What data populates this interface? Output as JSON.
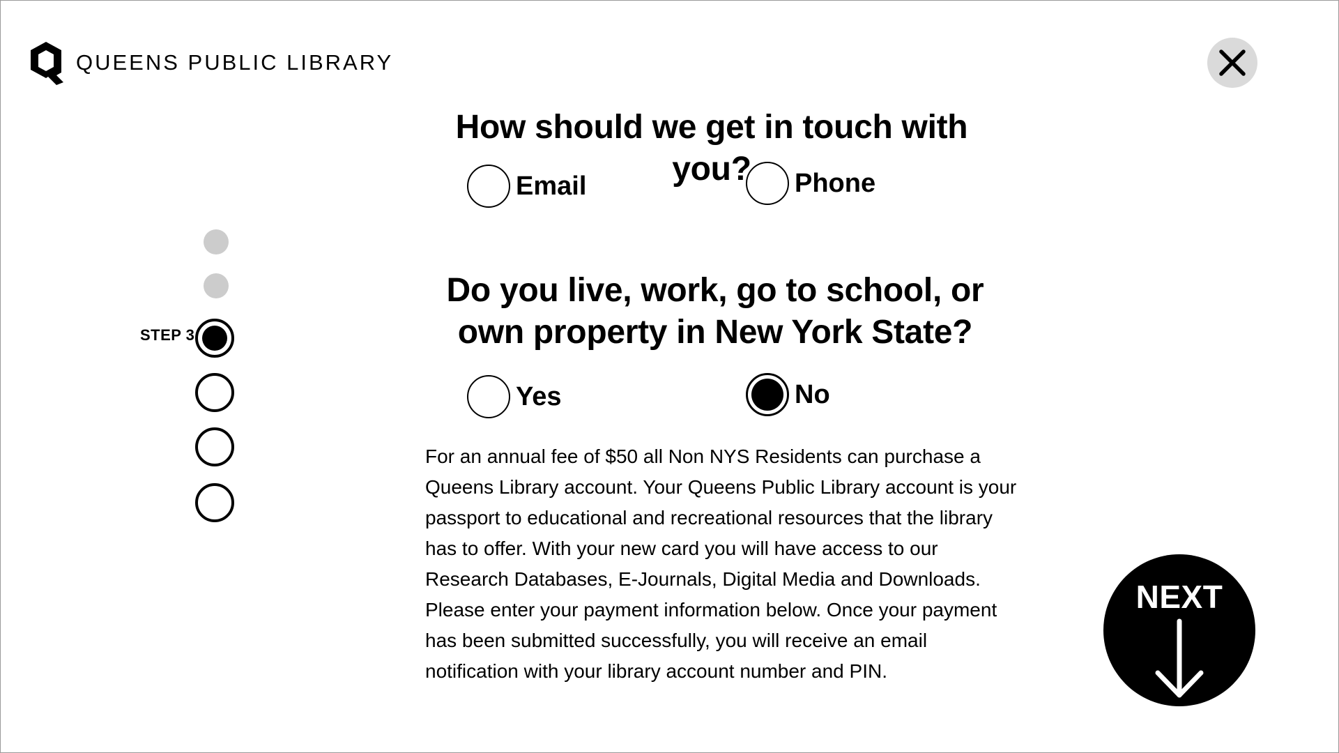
{
  "header": {
    "logo_text": "QUEENS PUBLIC LIBRARY",
    "close_icon": "close-icon"
  },
  "stepper": {
    "current_label": "STEP 3",
    "current_step": 3,
    "total_steps": 6,
    "completed_steps": 2
  },
  "contact_question": {
    "title": "How should we get in touch with you?",
    "options": [
      {
        "label": "Email",
        "selected": false
      },
      {
        "label": "Phone",
        "selected": false
      }
    ]
  },
  "residency_question": {
    "title": "Do you live, work, go to school, or own property in New York State?",
    "options": [
      {
        "label": "Yes",
        "selected": false
      },
      {
        "label": "No",
        "selected": true
      }
    ]
  },
  "info_text": "For an annual fee of $50 all Non NYS Residents can purchase a Queens Library account. Your Queens Public Library account is your passport to educational and recreational resources that the library has to offer. With your new card you will have access to our Research Databases, E-Journals, Digital Media and Downloads. Please enter your payment information below. Once your payment has been submitted successfully, you will receive an email notification with your library account number and PIN.",
  "next_button": {
    "label": "NEXT",
    "icon": "arrow-down-icon"
  },
  "colors": {
    "completed_step": "#cccccc",
    "close_button_bg": "#dadada",
    "next_button_bg": "#000000"
  }
}
